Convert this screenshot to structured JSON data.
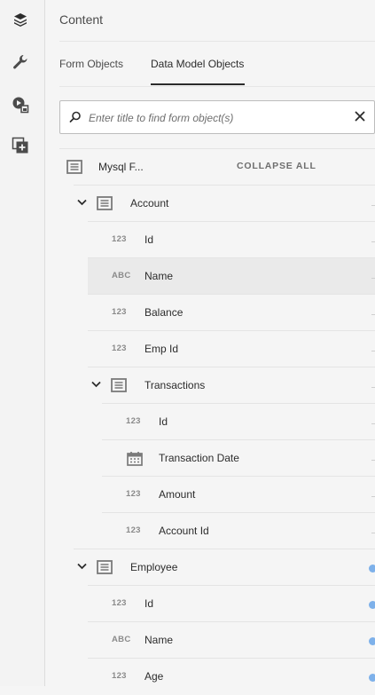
{
  "rail": {
    "icons": [
      "layers-icon",
      "wrench-icon",
      "media-icon",
      "add-fragment-icon"
    ]
  },
  "panel": {
    "title": "Content",
    "tabs": [
      {
        "label": "Form Objects"
      },
      {
        "label": "Data Model Objects",
        "active": true
      }
    ],
    "search": {
      "placeholder": "Enter title to find form object(s)"
    }
  },
  "tree": {
    "root": {
      "label": "Mysql F...",
      "action": "COLLAPSE ALL"
    },
    "items": [
      {
        "kind": "group",
        "label": "Account",
        "level": 1
      },
      {
        "kind": "field",
        "type": "123",
        "label": "Id",
        "level": 1
      },
      {
        "kind": "field",
        "type": "ABC",
        "label": "Name",
        "level": 1,
        "selected": true
      },
      {
        "kind": "field",
        "type": "123",
        "label": "Balance",
        "level": 1
      },
      {
        "kind": "field",
        "type": "123",
        "label": "Emp Id",
        "level": 1
      },
      {
        "kind": "group",
        "label": "Transactions",
        "level": 2
      },
      {
        "kind": "field",
        "type": "123",
        "label": "Id",
        "level": 2
      },
      {
        "kind": "field",
        "type": "calendar-icon",
        "label": "Transaction Date",
        "level": 2
      },
      {
        "kind": "field",
        "type": "123",
        "label": "Amount",
        "level": 2
      },
      {
        "kind": "field",
        "type": "123",
        "label": "Account Id",
        "level": 2
      },
      {
        "kind": "group",
        "label": "Employee",
        "level": 1,
        "marked": true
      },
      {
        "kind": "field",
        "type": "123",
        "label": "Id",
        "level": 1,
        "marked": true
      },
      {
        "kind": "field",
        "type": "ABC",
        "label": "Name",
        "level": 1,
        "marked": true
      },
      {
        "kind": "field",
        "type": "123",
        "label": "Age",
        "level": 1,
        "marked": true
      }
    ]
  },
  "colors": {
    "marker": "#7eb1ea",
    "selected_row": "#eaeaea",
    "text": "#2c2c2c"
  }
}
